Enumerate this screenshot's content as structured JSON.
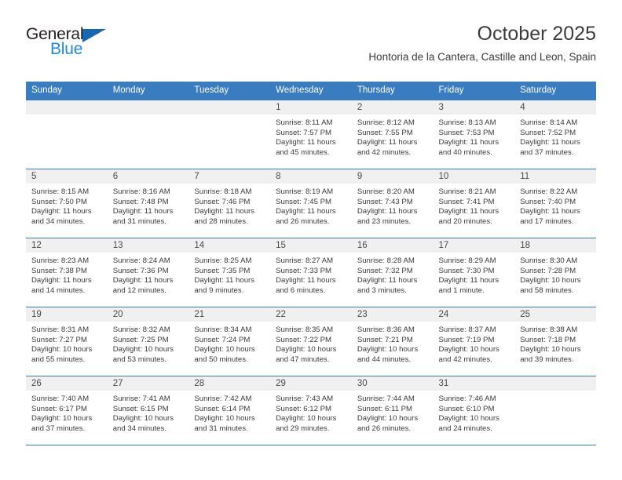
{
  "brand": {
    "name_top": "General",
    "name_bottom": "Blue",
    "triangle_color": "#1668b3",
    "blue_color": "#2288d6"
  },
  "header": {
    "title": "October 2025",
    "subtitle": "Hontoria de la Cantera, Castille and Leon, Spain"
  },
  "theme": {
    "header_blue": "#3a7cc0",
    "daynum_bg": "#f0f0f0",
    "text": "#3b3b3b"
  },
  "weekdays": [
    "Sunday",
    "Monday",
    "Tuesday",
    "Wednesday",
    "Thursday",
    "Friday",
    "Saturday"
  ],
  "labels": {
    "sunrise": "Sunrise:",
    "sunset": "Sunset:",
    "daylight": "Daylight:"
  },
  "weeks": [
    [
      {
        "day": "",
        "empty": true
      },
      {
        "day": "",
        "empty": true
      },
      {
        "day": "",
        "empty": true
      },
      {
        "day": "1",
        "sunrise": "Sunrise: 8:11 AM",
        "sunset": "Sunset: 7:57 PM",
        "daylight1": "Daylight: 11 hours",
        "daylight2": "and 45 minutes."
      },
      {
        "day": "2",
        "sunrise": "Sunrise: 8:12 AM",
        "sunset": "Sunset: 7:55 PM",
        "daylight1": "Daylight: 11 hours",
        "daylight2": "and 42 minutes."
      },
      {
        "day": "3",
        "sunrise": "Sunrise: 8:13 AM",
        "sunset": "Sunset: 7:53 PM",
        "daylight1": "Daylight: 11 hours",
        "daylight2": "and 40 minutes."
      },
      {
        "day": "4",
        "sunrise": "Sunrise: 8:14 AM",
        "sunset": "Sunset: 7:52 PM",
        "daylight1": "Daylight: 11 hours",
        "daylight2": "and 37 minutes."
      }
    ],
    [
      {
        "day": "5",
        "sunrise": "Sunrise: 8:15 AM",
        "sunset": "Sunset: 7:50 PM",
        "daylight1": "Daylight: 11 hours",
        "daylight2": "and 34 minutes."
      },
      {
        "day": "6",
        "sunrise": "Sunrise: 8:16 AM",
        "sunset": "Sunset: 7:48 PM",
        "daylight1": "Daylight: 11 hours",
        "daylight2": "and 31 minutes."
      },
      {
        "day": "7",
        "sunrise": "Sunrise: 8:18 AM",
        "sunset": "Sunset: 7:46 PM",
        "daylight1": "Daylight: 11 hours",
        "daylight2": "and 28 minutes."
      },
      {
        "day": "8",
        "sunrise": "Sunrise: 8:19 AM",
        "sunset": "Sunset: 7:45 PM",
        "daylight1": "Daylight: 11 hours",
        "daylight2": "and 26 minutes."
      },
      {
        "day": "9",
        "sunrise": "Sunrise: 8:20 AM",
        "sunset": "Sunset: 7:43 PM",
        "daylight1": "Daylight: 11 hours",
        "daylight2": "and 23 minutes."
      },
      {
        "day": "10",
        "sunrise": "Sunrise: 8:21 AM",
        "sunset": "Sunset: 7:41 PM",
        "daylight1": "Daylight: 11 hours",
        "daylight2": "and 20 minutes."
      },
      {
        "day": "11",
        "sunrise": "Sunrise: 8:22 AM",
        "sunset": "Sunset: 7:40 PM",
        "daylight1": "Daylight: 11 hours",
        "daylight2": "and 17 minutes."
      }
    ],
    [
      {
        "day": "12",
        "sunrise": "Sunrise: 8:23 AM",
        "sunset": "Sunset: 7:38 PM",
        "daylight1": "Daylight: 11 hours",
        "daylight2": "and 14 minutes."
      },
      {
        "day": "13",
        "sunrise": "Sunrise: 8:24 AM",
        "sunset": "Sunset: 7:36 PM",
        "daylight1": "Daylight: 11 hours",
        "daylight2": "and 12 minutes."
      },
      {
        "day": "14",
        "sunrise": "Sunrise: 8:25 AM",
        "sunset": "Sunset: 7:35 PM",
        "daylight1": "Daylight: 11 hours",
        "daylight2": "and 9 minutes."
      },
      {
        "day": "15",
        "sunrise": "Sunrise: 8:27 AM",
        "sunset": "Sunset: 7:33 PM",
        "daylight1": "Daylight: 11 hours",
        "daylight2": "and 6 minutes."
      },
      {
        "day": "16",
        "sunrise": "Sunrise: 8:28 AM",
        "sunset": "Sunset: 7:32 PM",
        "daylight1": "Daylight: 11 hours",
        "daylight2": "and 3 minutes."
      },
      {
        "day": "17",
        "sunrise": "Sunrise: 8:29 AM",
        "sunset": "Sunset: 7:30 PM",
        "daylight1": "Daylight: 11 hours",
        "daylight2": "and 1 minute."
      },
      {
        "day": "18",
        "sunrise": "Sunrise: 8:30 AM",
        "sunset": "Sunset: 7:28 PM",
        "daylight1": "Daylight: 10 hours",
        "daylight2": "and 58 minutes."
      }
    ],
    [
      {
        "day": "19",
        "sunrise": "Sunrise: 8:31 AM",
        "sunset": "Sunset: 7:27 PM",
        "daylight1": "Daylight: 10 hours",
        "daylight2": "and 55 minutes."
      },
      {
        "day": "20",
        "sunrise": "Sunrise: 8:32 AM",
        "sunset": "Sunset: 7:25 PM",
        "daylight1": "Daylight: 10 hours",
        "daylight2": "and 53 minutes."
      },
      {
        "day": "21",
        "sunrise": "Sunrise: 8:34 AM",
        "sunset": "Sunset: 7:24 PM",
        "daylight1": "Daylight: 10 hours",
        "daylight2": "and 50 minutes."
      },
      {
        "day": "22",
        "sunrise": "Sunrise: 8:35 AM",
        "sunset": "Sunset: 7:22 PM",
        "daylight1": "Daylight: 10 hours",
        "daylight2": "and 47 minutes."
      },
      {
        "day": "23",
        "sunrise": "Sunrise: 8:36 AM",
        "sunset": "Sunset: 7:21 PM",
        "daylight1": "Daylight: 10 hours",
        "daylight2": "and 44 minutes."
      },
      {
        "day": "24",
        "sunrise": "Sunrise: 8:37 AM",
        "sunset": "Sunset: 7:19 PM",
        "daylight1": "Daylight: 10 hours",
        "daylight2": "and 42 minutes."
      },
      {
        "day": "25",
        "sunrise": "Sunrise: 8:38 AM",
        "sunset": "Sunset: 7:18 PM",
        "daylight1": "Daylight: 10 hours",
        "daylight2": "and 39 minutes."
      }
    ],
    [
      {
        "day": "26",
        "sunrise": "Sunrise: 7:40 AM",
        "sunset": "Sunset: 6:17 PM",
        "daylight1": "Daylight: 10 hours",
        "daylight2": "and 37 minutes."
      },
      {
        "day": "27",
        "sunrise": "Sunrise: 7:41 AM",
        "sunset": "Sunset: 6:15 PM",
        "daylight1": "Daylight: 10 hours",
        "daylight2": "and 34 minutes."
      },
      {
        "day": "28",
        "sunrise": "Sunrise: 7:42 AM",
        "sunset": "Sunset: 6:14 PM",
        "daylight1": "Daylight: 10 hours",
        "daylight2": "and 31 minutes."
      },
      {
        "day": "29",
        "sunrise": "Sunrise: 7:43 AM",
        "sunset": "Sunset: 6:12 PM",
        "daylight1": "Daylight: 10 hours",
        "daylight2": "and 29 minutes."
      },
      {
        "day": "30",
        "sunrise": "Sunrise: 7:44 AM",
        "sunset": "Sunset: 6:11 PM",
        "daylight1": "Daylight: 10 hours",
        "daylight2": "and 26 minutes."
      },
      {
        "day": "31",
        "sunrise": "Sunrise: 7:46 AM",
        "sunset": "Sunset: 6:10 PM",
        "daylight1": "Daylight: 10 hours",
        "daylight2": "and 24 minutes."
      },
      {
        "day": "",
        "empty": true
      }
    ]
  ]
}
